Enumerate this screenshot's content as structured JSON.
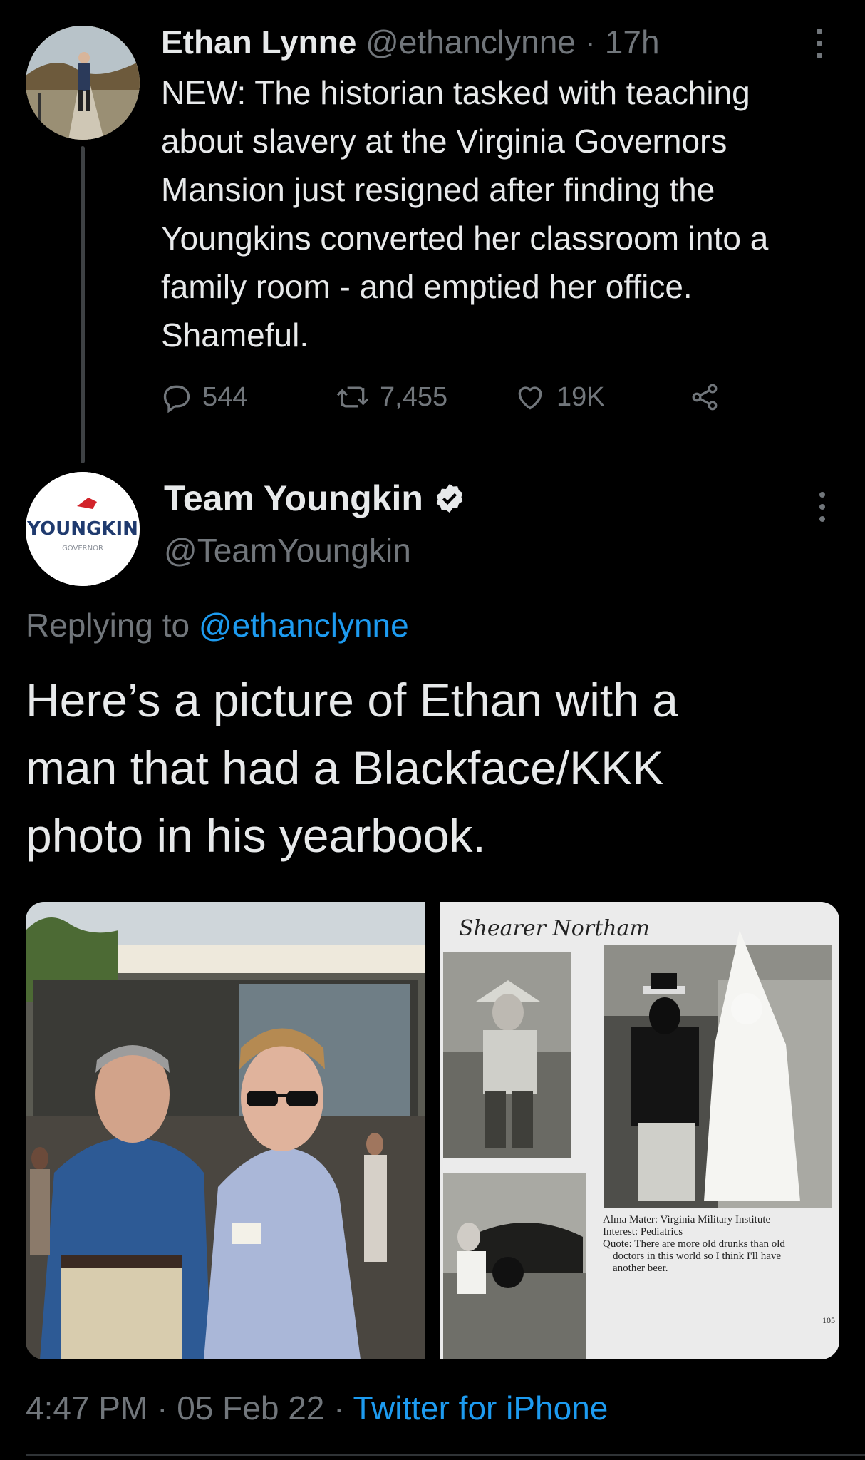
{
  "tweet1": {
    "author_name": "Ethan Lynne",
    "handle": "@ethanclynne",
    "separator": "·",
    "time_ago": "17h",
    "text_lines": [
      "NEW: The historian tasked with teaching",
      "about slavery at the Virginia Governors",
      "Mansion just resigned after finding the",
      "Youngkins converted her classroom into a",
      "family room - and emptied her office.",
      "Shameful."
    ],
    "replies": "544",
    "retweets": "7,455",
    "likes": "19K",
    "icons": [
      "reply-icon",
      "retweet-icon",
      "like-icon",
      "share-icon",
      "more-icon"
    ]
  },
  "tweet2": {
    "author_name": "Team Youngkin",
    "verified": true,
    "handle": "@TeamYoungkin",
    "avatar_text": "YOUNGKIN",
    "avatar_subtext": "GOVERNOR",
    "replying_label": "Replying to",
    "replying_handle": "@ethanclynne",
    "text_lines": [
      "Here’s a picture of Ethan with a",
      "man that had a Blackface/KKK",
      "photo in his yearbook."
    ],
    "media": {
      "yearbook_title": "Shearer Northam",
      "yearbook_caption": [
        "Alma Mater: Virginia Military Institute",
        "Interest: Pediatrics",
        "Quote: There are more old drunks than old",
        "doctors in this world so I think I'll have",
        "another beer."
      ],
      "yearbook_page": "105"
    },
    "time": "4:47 PM",
    "date": "05 Feb 22",
    "source": "Twitter for iPhone",
    "dot": "·"
  },
  "colors": {
    "background": "#000000",
    "text": "#e7e9ea",
    "muted": "#71767b",
    "link": "#1d9bf0",
    "brand_red": "#d2232a",
    "brand_navy": "#1f3a6e"
  }
}
